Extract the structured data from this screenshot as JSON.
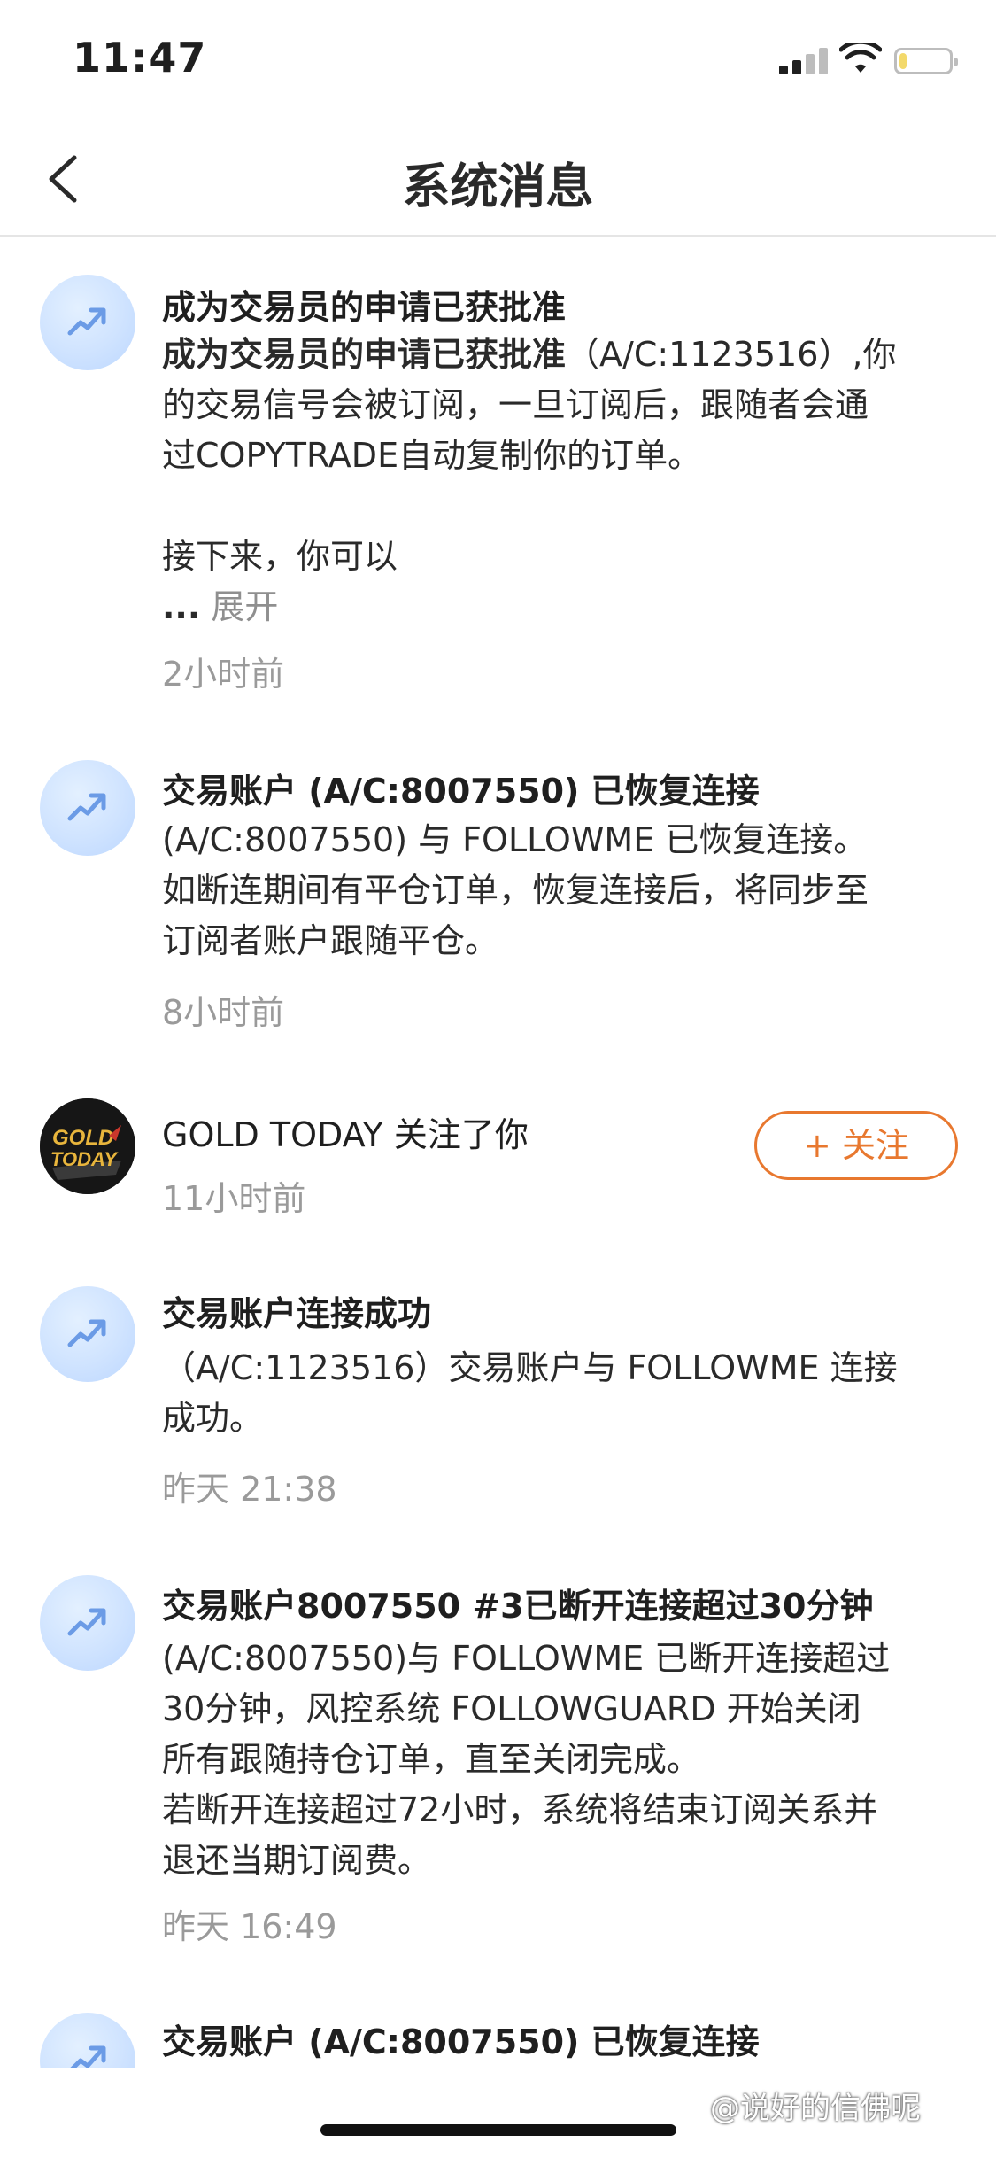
{
  "status_bar": {
    "time": "11:47",
    "battery_level": 0.15
  },
  "nav": {
    "title": "系统消息"
  },
  "messages": [
    {
      "title": "成为交易员的申请已获批准",
      "body_strong": "成为交易员的申请已获批准",
      "body_lines": [
        "（A/C:1123516）,你",
        "的交易信号会被订阅，一旦订阅后，跟随者会通",
        "过COPYTRADE自动复制你的订单。",
        "接下来，你可以"
      ],
      "ellipsis": "...",
      "expand_label": "展开",
      "time": "2小时前"
    },
    {
      "title": "交易账户 (A/C:8007550) 已恢复连接",
      "body_lines": [
        "(A/C:8007550) 与  FOLLOWME  已恢复连接。",
        "如断连期间有平仓订单，恢复连接后，将同步至",
        "订阅者账户跟随平仓。"
      ],
      "time": "8小时前"
    },
    {
      "title": "GOLD TODAY 关注了你",
      "avatar_text": [
        "GOLD",
        "TODAY"
      ],
      "follow_label": "+ 关注",
      "time": "11小时前"
    },
    {
      "title": "交易账户连接成功",
      "body_lines": [
        "（A/C:1123516）交易账户与 FOLLOWME 连接",
        "成功。"
      ],
      "time": "昨天 21:38"
    },
    {
      "title": "交易账户8007550 #3已断开连接超过30分钟",
      "body_lines": [
        "(A/C:8007550)与 FOLLOWME 已断开连接超过",
        "30分钟，风控系统 FOLLOWGUARD 开始关闭",
        "所有跟随持仓订单，直至关闭完成。",
        "若断开连接超过72小时，系统将结束订阅关系并",
        "退还当期订阅费。"
      ],
      "time": "昨天 16:49"
    },
    {
      "title": "交易账户 (A/C:8007550) 已恢复连接"
    }
  ],
  "watermark": "@说好的信佛呢",
  "colors": {
    "accent": "#e8782f",
    "avatar_bg": "#cfe3ff",
    "icon": "#6b9be6",
    "muted": "#9a9a9a"
  }
}
